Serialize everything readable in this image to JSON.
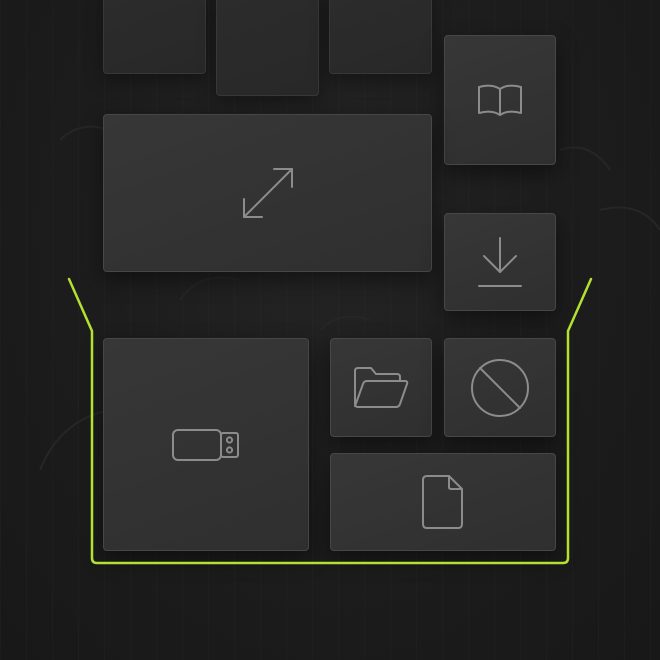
{
  "colors": {
    "background": "#1b1b1b",
    "tile": "#333333",
    "tile_border": "#474747",
    "icon_stroke": "#8c8c8c",
    "accent_outline": "#b4e031"
  },
  "tiles": [
    {
      "name": "top-tile-1",
      "icon": null
    },
    {
      "name": "top-tile-2",
      "icon": null
    },
    {
      "name": "top-tile-3",
      "icon": null
    },
    {
      "name": "book-tile",
      "icon": "book-icon"
    },
    {
      "name": "expand-tile",
      "icon": "expand-arrows-icon"
    },
    {
      "name": "download-tile",
      "icon": "download-icon"
    },
    {
      "name": "usb-drive-tile",
      "icon": "usb-drive-icon"
    },
    {
      "name": "folder-tile",
      "icon": "folder-open-icon"
    },
    {
      "name": "blocked-tile",
      "icon": "prohibited-icon"
    },
    {
      "name": "file-tile",
      "icon": "file-icon"
    }
  ]
}
